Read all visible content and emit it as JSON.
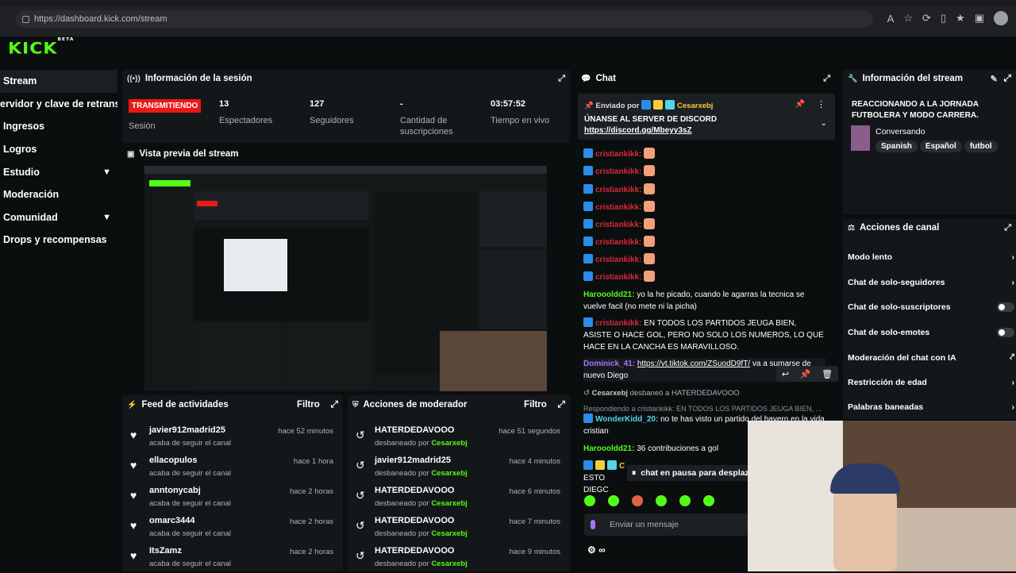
{
  "browser": {
    "url": "https://dashboard.kick.com/stream"
  },
  "brand": {
    "logo": "KICK",
    "beta": "BETA",
    "accent": "#53fc18"
  },
  "sidebar": {
    "items": [
      {
        "label": "Stream",
        "active": true
      },
      {
        "label": "ervidor y clave de retransmi"
      },
      {
        "label": "Ingresos"
      },
      {
        "label": "Logros"
      },
      {
        "label": "Estudio",
        "chevron": true
      },
      {
        "label": "Moderación"
      },
      {
        "label": "Comunidad",
        "chevron": true
      },
      {
        "label": "Drops y recompensas"
      }
    ]
  },
  "session": {
    "title": "Información de la sesión",
    "status_badge": "TRANSMITIENDO",
    "stats": [
      {
        "value": "",
        "label": "Sesión"
      },
      {
        "value": "13",
        "label": "Espectadores"
      },
      {
        "value": "127",
        "label": "Seguidores"
      },
      {
        "value": "-",
        "label": "Cantidad de suscripciones"
      },
      {
        "value": "03:57:52",
        "label": "Tiempo en vivo"
      }
    ]
  },
  "preview": {
    "title": "Vista previa del stream"
  },
  "activity": {
    "title": "Feed de actividades",
    "filter": "Filtro",
    "rows": [
      {
        "name": "javier912madrid25",
        "sub": "acaba de seguir el canal",
        "time": "hace 52 minutos"
      },
      {
        "name": "ellacopulos",
        "sub": "acaba de seguir el canal",
        "time": "hace 1 hora"
      },
      {
        "name": "anntonycabj",
        "sub": "acaba de seguir el canal",
        "time": "hace 2 horas"
      },
      {
        "name": "omarc3444",
        "sub": "acaba de seguir el canal",
        "time": "hace 2 horas"
      },
      {
        "name": "ItsZamz",
        "sub": "acaba de seguir el canal",
        "time": "hace 2 horas"
      }
    ]
  },
  "mod_actions": {
    "title": "Acciones de moderador",
    "filter": "Filtro",
    "rows": [
      {
        "name": "HATERDEDAVOOO",
        "sub": "desbaneado por",
        "by": "Cesarxebj",
        "time": "hace 51 segundos"
      },
      {
        "name": "javier912madrid25",
        "sub": "desbaneado por",
        "by": "Cesarxebj",
        "time": "hace 4 minutos"
      },
      {
        "name": "HATERDEDAVOOO",
        "sub": "desbaneado por",
        "by": "Cesarxebj",
        "time": "hace 6 minutos"
      },
      {
        "name": "HATERDEDAVOOO",
        "sub": "desbaneado por",
        "by": "Cesarxebj",
        "time": "hace 7 minutos"
      },
      {
        "name": "HATERDEDAVOOO",
        "sub": "desbaneado por",
        "by": "Cesarxebj",
        "time": "hace 9 minutos"
      }
    ]
  },
  "chat": {
    "title": "Chat",
    "pinned": {
      "sent_by": "Enviado por",
      "user": "Cesarxebj",
      "text": "ÚNANSE AL SERVER DE DISCORD",
      "link": "https://discord.gg/Mbeyy3sZ"
    },
    "repeat_user": "cristiankikk:",
    "messages": [
      {
        "user": "Haroooldd21:",
        "text": "yo la he picado, cuando le agarras la tecnica se vuelve facil (no mete ni la picha)"
      },
      {
        "user": "cristiankikk:",
        "text": "EN TODOS LOS PARTIDOS JEUGA BIEN, ASISTE O HACE GOL, PERO NO SOLO LOS NUMEROS, LO QUE HACE EN LA CANCHA ES MARAVILLOSO."
      },
      {
        "user": "Dominick_41:",
        "link": "https://vt.tiktok.com/ZSuodD9fT/",
        "text": "va a sumarse de nuevo Diego"
      },
      {
        "user": "Cesarxebj",
        "text": "desbaneó a HATERDEDAVOOO"
      },
      {
        "reply": "Respondiendo a cristiankikk: EN TODOS LOS PARTIDOS JEUGA BIEN, ..."
      },
      {
        "user": "WonderKidd_20:",
        "text": "no te has visto un partido del bayern en la vida cristian"
      },
      {
        "user": "Haroooldd21:",
        "text": "36 contribuciones a gol"
      },
      {
        "user": "C",
        "text": "ESTO DIEGC"
      }
    ],
    "paused": "chat en pausa para desplaz",
    "input_placeholder": "Enviar un mensaje"
  },
  "stream_info": {
    "title": "Información del stream",
    "stream_title": "REACCIONANDO A LA JORNADA FUTBOLERA Y MODO CARRERA.",
    "category": "Conversando",
    "tags": [
      "Spanish",
      "Español",
      "futbol"
    ]
  },
  "channel_actions": {
    "title": "Acciones de canal",
    "items": [
      {
        "label": "Modo lento",
        "control": "chevron"
      },
      {
        "label": "Chat de solo-seguidores",
        "control": "chevron"
      },
      {
        "label": "Chat de solo-suscriptores",
        "control": "toggle"
      },
      {
        "label": "Chat de solo-emotes",
        "control": "toggle"
      },
      {
        "label": "Moderación del chat con IA",
        "control": "external"
      },
      {
        "label": "Restricción de edad",
        "control": "chevron"
      },
      {
        "label": "Palabras baneadas",
        "control": "chevron"
      }
    ]
  }
}
